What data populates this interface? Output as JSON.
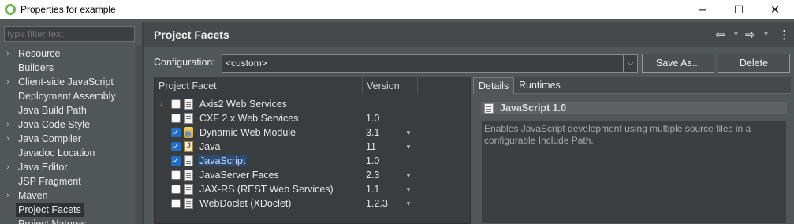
{
  "window": {
    "title": "Properties for example",
    "minimize": "─",
    "maximize": "☐",
    "close": "✕"
  },
  "filter": {
    "placeholder": "type filter text"
  },
  "tree": [
    {
      "label": "Resource",
      "expandable": true
    },
    {
      "label": "Builders",
      "expandable": false
    },
    {
      "label": "Client-side JavaScript",
      "expandable": true
    },
    {
      "label": "Deployment Assembly",
      "expandable": false
    },
    {
      "label": "Java Build Path",
      "expandable": false
    },
    {
      "label": "Java Code Style",
      "expandable": true
    },
    {
      "label": "Java Compiler",
      "expandable": true
    },
    {
      "label": "Javadoc Location",
      "expandable": false
    },
    {
      "label": "Java Editor",
      "expandable": true
    },
    {
      "label": "JSP Fragment",
      "expandable": false
    },
    {
      "label": "Maven",
      "expandable": true
    },
    {
      "label": "Project Facets",
      "expandable": false,
      "selected": true
    },
    {
      "label": "Project Natures",
      "expandable": false
    }
  ],
  "header": {
    "title": "Project Facets",
    "back_icon": "back-arrow-icon",
    "forward_icon": "forward-arrow-icon",
    "menu_icon": "kebab-menu-icon"
  },
  "configuration": {
    "label": "Configuration:",
    "value": "<custom>",
    "save_as": "Save As...",
    "delete": "Delete"
  },
  "facets": {
    "col_facet": "Project Facet",
    "col_version": "Version",
    "rows": [
      {
        "name": "Axis2 Web Services",
        "version": "",
        "checked": false,
        "expandable": true,
        "icon": "doc-icon",
        "dropdown": false
      },
      {
        "name": "CXF 2.x Web Services",
        "version": "1.0",
        "checked": false,
        "expandable": false,
        "icon": "doc-icon",
        "dropdown": false
      },
      {
        "name": "Dynamic Web Module",
        "version": "3.1",
        "checked": true,
        "expandable": false,
        "icon": "web-module-icon",
        "dropdown": true
      },
      {
        "name": "Java",
        "version": "11",
        "checked": true,
        "expandable": false,
        "icon": "java-icon",
        "dropdown": true
      },
      {
        "name": "JavaScript",
        "version": "1.0",
        "checked": true,
        "expandable": false,
        "icon": "doc-icon",
        "dropdown": false,
        "selected": true
      },
      {
        "name": "JavaServer Faces",
        "version": "2.3",
        "checked": false,
        "expandable": false,
        "icon": "doc-icon",
        "dropdown": true
      },
      {
        "name": "JAX-RS (REST Web Services)",
        "version": "1.1",
        "checked": false,
        "expandable": false,
        "icon": "doc-icon",
        "dropdown": true
      },
      {
        "name": "WebDoclet (XDoclet)",
        "version": "1.2.3",
        "checked": false,
        "expandable": false,
        "icon": "doc-icon",
        "dropdown": true
      }
    ]
  },
  "details": {
    "tab_details": "Details",
    "tab_runtimes": "Runtimes",
    "title": "JavaScript 1.0",
    "description": "Enables JavaScript development using multiple source files in a configurable Include Path."
  }
}
